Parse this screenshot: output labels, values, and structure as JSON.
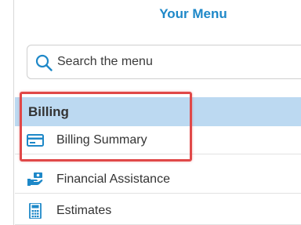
{
  "menu": {
    "title": "Your Menu",
    "search": {
      "placeholder": "Search the menu",
      "value": "",
      "icon": "search-icon"
    },
    "section": {
      "label": "Billing"
    },
    "items": [
      {
        "label": "Billing Summary",
        "icon": "credit-card-icon"
      },
      {
        "label": "Financial Assistance",
        "icon": "money-hand-icon"
      },
      {
        "label": "Estimates",
        "icon": "calculator-icon"
      }
    ]
  },
  "colors": {
    "accent": "#1e88c8",
    "section_bg": "#bcd9f1",
    "highlight": "#e04848"
  }
}
